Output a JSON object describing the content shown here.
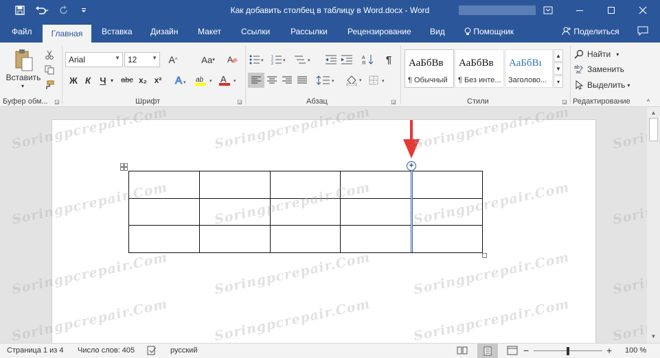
{
  "titlebar": {
    "title": "Как добавить столбец в таблицу в Word.docx  -  Word",
    "save_icon": "save-icon",
    "undo_icon": "undo-icon",
    "redo_icon": "redo-icon",
    "customize_icon": "customize-qat-icon",
    "ribbon_options_icon": "ribbon-display-options-icon",
    "minimize": "minimize-icon",
    "maximize": "maximize-icon",
    "close": "close-icon"
  },
  "tabs": [
    "Файл",
    "Главная",
    "Вставка",
    "Дизайн",
    "Макет",
    "Ссылки",
    "Рассылки",
    "Рецензирование",
    "Вид"
  ],
  "tellme": "Помощник",
  "share": "Поделиться",
  "ribbon": {
    "clipboard": {
      "paste": "Вставить",
      "label": "Буфер обм..."
    },
    "font": {
      "name": "Arial",
      "size": "12",
      "bold": "Ж",
      "italic": "К",
      "underline": "Ч",
      "strike": "abc",
      "sub": "x₂",
      "sup": "x²",
      "grow": "A",
      "case": "Aa",
      "label": "Шрифт"
    },
    "paragraph": {
      "label": "Абзац"
    },
    "styles": {
      "label": "Стили",
      "items": [
        {
          "sample": "АаБбВв",
          "name": "¶ Обычный"
        },
        {
          "sample": "АаБбВв",
          "name": "¶ Без инте..."
        },
        {
          "sample": "АаБбВı",
          "name": "Заголово..."
        }
      ]
    },
    "editing": {
      "find": "Найти",
      "replace": "Заменить",
      "select": "Выделить",
      "label": "Редактирование"
    }
  },
  "document": {
    "table": {
      "rows": 3,
      "cols": 5
    },
    "watermark": "Soringpcrepair.Com",
    "colors": {
      "arrow": "#e53935",
      "insert_line": "#2f5a9c",
      "accent": "#2b579a"
    }
  },
  "status": {
    "page": "Страница 1 из 4",
    "words": "Число слов: 405",
    "language": "русский",
    "zoom": "100 %"
  }
}
